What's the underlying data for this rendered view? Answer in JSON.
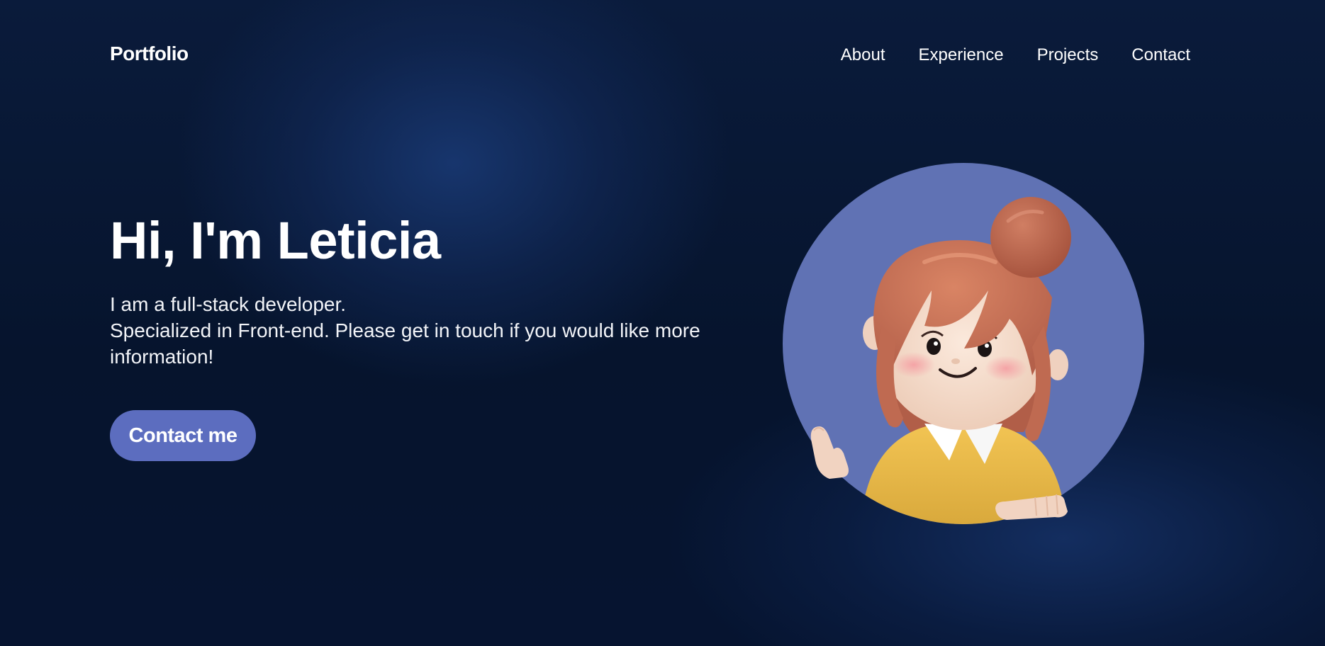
{
  "nav": {
    "logo": "Portfolio",
    "links": [
      {
        "label": "About"
      },
      {
        "label": "Experience"
      },
      {
        "label": "Projects"
      },
      {
        "label": "Contact"
      }
    ]
  },
  "hero": {
    "title": "Hi, I'm Leticia",
    "description_lines": [
      "I am a full-stack developer.",
      "Specialized in Front-end. Please get in touch if you would like more",
      "information!"
    ],
    "cta_label": "Contact me"
  },
  "colors": {
    "background": "#071631",
    "accent_button": "#5c6dbf",
    "avatar_circle": "#6072b4"
  },
  "avatar": {
    "icon": "cartoon-girl-avatar"
  }
}
